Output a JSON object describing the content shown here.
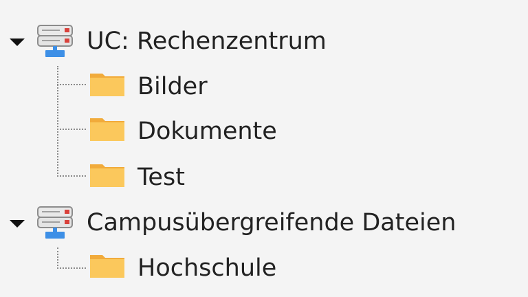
{
  "tree": {
    "nodes": [
      {
        "label": "UC: Rechenzentrum",
        "icon": "network-drive-icon",
        "expanded": true,
        "children": [
          {
            "label": "Bilder",
            "icon": "folder-icon"
          },
          {
            "label": "Dokumente",
            "icon": "folder-icon"
          },
          {
            "label": "Test",
            "icon": "folder-icon"
          }
        ]
      },
      {
        "label": "Campusübergreifende Dateien",
        "icon": "network-drive-icon",
        "expanded": true,
        "children": [
          {
            "label": "Hochschule",
            "icon": "folder-icon"
          }
        ]
      }
    ]
  },
  "colors": {
    "background": "#f4f4f4",
    "folder_fill": "#fbc85c",
    "folder_tab": "#f1ab3b",
    "drive_accent": "#3d8fe6",
    "drive_status_led": "#d9413b",
    "connector": "#8a8a8a"
  }
}
